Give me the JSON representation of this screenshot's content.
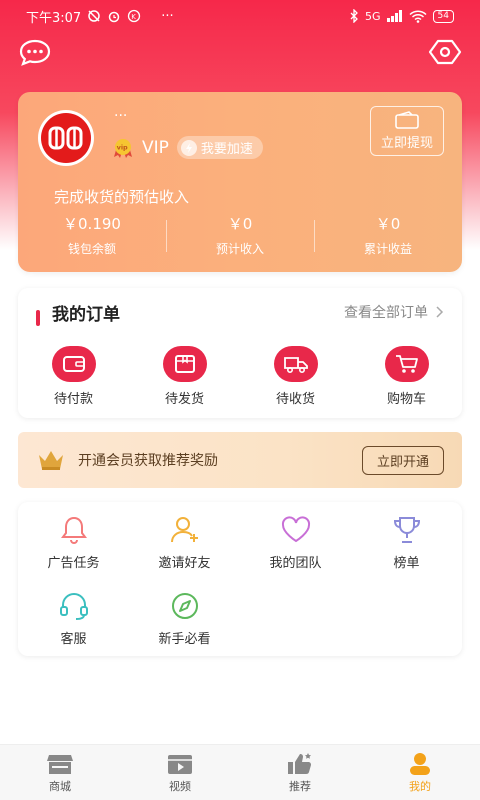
{
  "status": {
    "time": "下午3:07",
    "dots": "···",
    "network": "5G",
    "battery": "54"
  },
  "profile": {
    "username": "···",
    "vip_label": "VIP",
    "speedup_label": "我要加速",
    "withdraw_label": "立即提现",
    "estimate_label": "完成收货的预估收入",
    "stats": [
      {
        "value": "￥0.190",
        "label": "钱包余额"
      },
      {
        "value": "￥0",
        "label": "预计收入"
      },
      {
        "value": "￥0",
        "label": "累计收益"
      }
    ]
  },
  "orders": {
    "title": "我的订单",
    "view_all": "查看全部订单",
    "items": [
      {
        "label": "待付款",
        "icon": "wallet-icon"
      },
      {
        "label": "待发货",
        "icon": "box-icon"
      },
      {
        "label": "待收货",
        "icon": "truck-icon"
      },
      {
        "label": "购物车",
        "icon": "cart-icon"
      }
    ]
  },
  "member": {
    "text": "开通会员获取推荐奖励",
    "button": "立即开通"
  },
  "tools": [
    {
      "label": "广告任务",
      "icon": "bell-icon",
      "color": "#f47a7a"
    },
    {
      "label": "邀请好友",
      "icon": "add-user-icon",
      "color": "#f2b13a"
    },
    {
      "label": "我的团队",
      "icon": "heart-icon",
      "color": "#c86fd6"
    },
    {
      "label": "榜单",
      "icon": "trophy-icon",
      "color": "#8b8bd9"
    },
    {
      "label": "客服",
      "icon": "headset-icon",
      "color": "#3bbfbf"
    },
    {
      "label": "新手必看",
      "icon": "compass-icon",
      "color": "#5cb85c"
    }
  ],
  "nav": [
    {
      "label": "商城",
      "icon": "store-icon",
      "active": false
    },
    {
      "label": "视频",
      "icon": "video-icon",
      "active": false
    },
    {
      "label": "推荐",
      "icon": "thumbs-up-icon",
      "active": false
    },
    {
      "label": "我的",
      "icon": "user-icon",
      "active": true
    }
  ],
  "colors": {
    "accent": "#e8284a",
    "card_gradient_start": "#fca77a",
    "nav_active": "#f3a21a"
  }
}
